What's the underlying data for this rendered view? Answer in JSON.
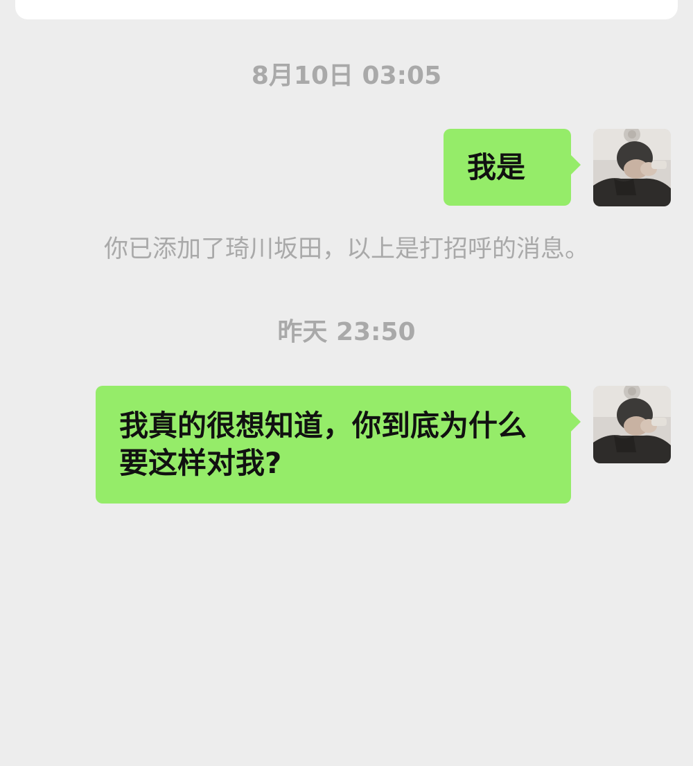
{
  "chat": {
    "timestamp_1": "8月10日 03:05",
    "message_1": "我是",
    "system_note": "你已添加了琦川坂田，以上是打招呼的消息。",
    "timestamp_2": "昨天 23:50",
    "message_2": "我真的很想知道，你到底为什么要这样对我?"
  },
  "colors": {
    "background": "#ededed",
    "bubble": "#95ec69",
    "meta_text": "#a9a9a9",
    "message_text": "#111111"
  },
  "icons": {
    "avatar": "user-avatar-photo"
  }
}
